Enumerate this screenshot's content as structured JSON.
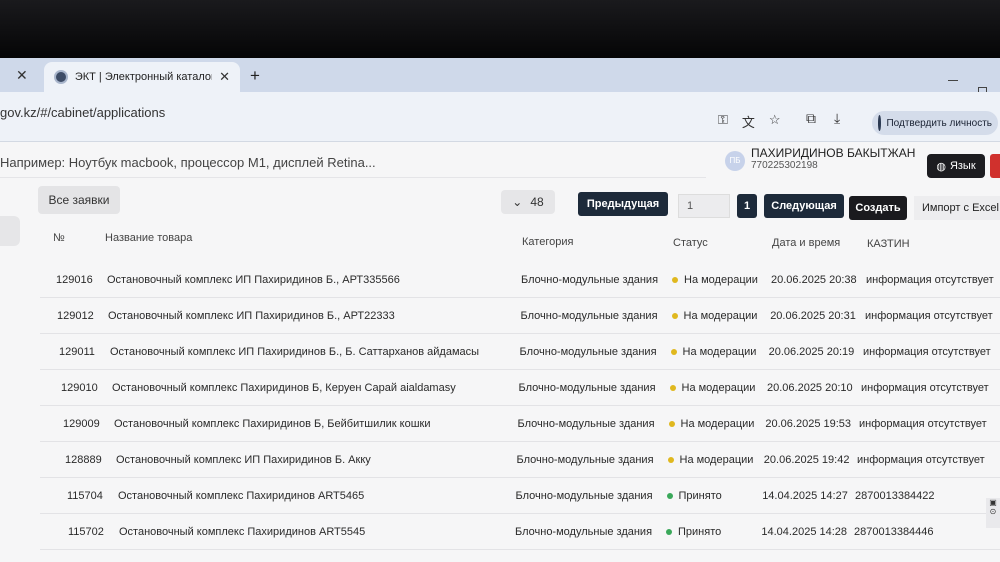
{
  "browser": {
    "tab_title": "ЭКТ | Электронный каталог тов",
    "url": "gov.kz/#/cabinet/applications",
    "verify_label": "Подтвердить личность"
  },
  "header": {
    "search_placeholder": "Например: Ноутбук macbook, процессор M1, дисплей Retina...",
    "user_initials": "ПБ",
    "user_name": "ПАХИРИДИНОВ БАКЫТЖАН",
    "user_phone": "77022530219​8",
    "language_label": "Язык"
  },
  "controls": {
    "filter_label": "Все заявки",
    "per_page": "48",
    "prev_label": "Предыдущая",
    "page_input": "1",
    "current_page": "1",
    "next_label": "Следующая",
    "create_label": "Создать",
    "import_label": "Импорт с Excel"
  },
  "table": {
    "columns": [
      "№",
      "Название товара",
      "Категория",
      "Статус",
      "Дата и время",
      "КАЗТИН"
    ],
    "rows": [
      {
        "id": "129016",
        "name": "Остановочный комплекс ИП Пахиридинов Б., АРТ335566",
        "category": "Блочно-модульные здания",
        "status": "На модерации",
        "status_color": "#e0b81e",
        "datetime": "20.06.2025 20:38",
        "kaztin": "информация отсутствует"
      },
      {
        "id": "129012",
        "name": "Остановочный комплекс ИП Пахиридинов Б., АРТ22333",
        "category": "Блочно-модульные здания",
        "status": "На модерации",
        "status_color": "#e0b81e",
        "datetime": "20.06.2025 20:31",
        "kaztin": "информация отсутствует"
      },
      {
        "id": "129011",
        "name": "Остановочный комплекс ИП Пахиридинов Б., Б. Саттарханов айдамасы",
        "category": "Блочно-модульные здания",
        "status": "На модерации",
        "status_color": "#e0b81e",
        "datetime": "20.06.2025 20:19",
        "kaztin": "информация отсутствует"
      },
      {
        "id": "129010",
        "name": "Остановочный комплекс Пахиридинов Б, Керуен Сарай aialdamasy",
        "category": "Блочно-модульные здания",
        "status": "На модерации",
        "status_color": "#e0b81e",
        "datetime": "20.06.2025 20:10",
        "kaztin": "информация отсутствует"
      },
      {
        "id": "129009",
        "name": "Остановочный комплекс Пахиридинов Б, Бейбитшилик кошки",
        "category": "Блочно-модульные здания",
        "status": "На модерации",
        "status_color": "#e0b81e",
        "datetime": "20.06.2025 19:53",
        "kaztin": "информация отсутствует"
      },
      {
        "id": "128889",
        "name": "Остановочный комплекс ИП Пахиридинов Б. Акку",
        "category": "Блочно-модульные здания",
        "status": "На модерации",
        "status_color": "#e0b81e",
        "datetime": "20.06.2025 19:42",
        "kaztin": "информация отсутствует"
      },
      {
        "id": "115704",
        "name": "Остановочный комплекс Пахиридинов ART5465",
        "category": "Блочно-модульные здания",
        "status": "Принято",
        "status_color": "#3aa85a",
        "datetime": "14.04.2025 14:27",
        "kaztin": "2870013384422",
        "kaztin_link": "true"
      },
      {
        "id": "115702",
        "name": "Остановочный комплекс Пахиридинов ART5545",
        "category": "Блочно-модульные здания",
        "status": "Принято",
        "status_color": "#3aa85a",
        "datetime": "14.04.2025 14:28",
        "kaztin": "2870013384446",
        "kaztin_link": "true"
      }
    ]
  }
}
